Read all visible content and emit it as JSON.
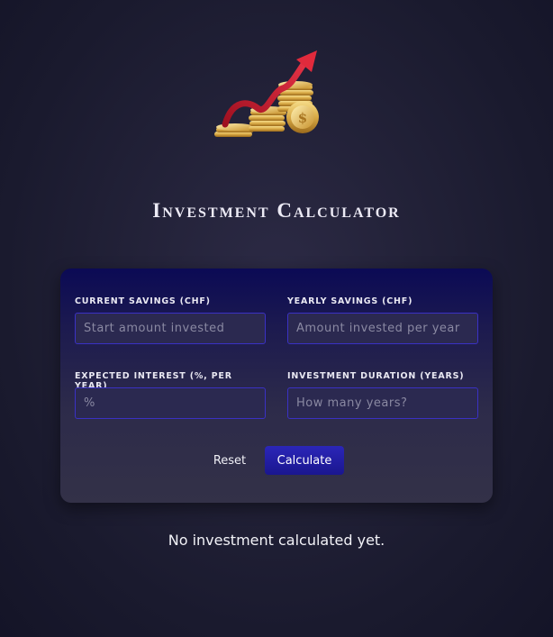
{
  "header": {
    "title": "Investment Calculator",
    "logo_icon": "coins-growth-icon"
  },
  "form": {
    "current_savings": {
      "label": "Current Savings (CHF)",
      "value": "",
      "placeholder": "Start amount invested"
    },
    "yearly_savings": {
      "label": "Yearly Savings (CHF)",
      "value": "",
      "placeholder": "Amount invested per year"
    },
    "expected_interest": {
      "label": "Expected Interest (%, per year)",
      "value": "",
      "placeholder": "%"
    },
    "investment_duration": {
      "label": "Investment Duration (years)",
      "value": "",
      "placeholder": "How many years?"
    }
  },
  "actions": {
    "reset_label": "Reset",
    "calculate_label": "Calculate"
  },
  "result": {
    "message": "No investment calculated yet."
  },
  "colors": {
    "accent": "#2b26b8",
    "input_border": "#3a31c4",
    "card_top": "#0b0a55",
    "background": "#232239"
  }
}
